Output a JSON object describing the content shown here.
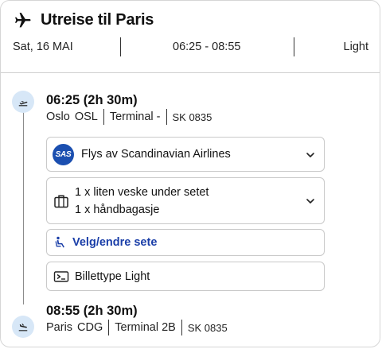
{
  "header": {
    "title": "Utreise til Paris",
    "date": "Sat, 16 MAI",
    "time_range": "06:25 - 08:55",
    "ticket_type": "Light",
    "icon": "plane-icon"
  },
  "departure": {
    "time_duration": "06:25  (2h 30m)",
    "city": "Oslo",
    "airport": "OSL",
    "terminal": "Terminal  -",
    "flight_no": "SK 0835",
    "icon": "takeoff-icon"
  },
  "details": {
    "airline": {
      "logo_text": "SAS",
      "label": "Flys av Scandinavian Airlines",
      "icon": "chevron-down-icon"
    },
    "baggage": {
      "line1": "1 x liten veske under setet",
      "line2": "1 x håndbagasje",
      "icon": "bag-icon"
    },
    "seat": {
      "label": "Velg/endre sete",
      "icon": "seat-icon"
    },
    "ticket": {
      "label": "Billettype Light",
      "icon": "ticket-icon"
    }
  },
  "arrival": {
    "time_duration": "08:55  (2h 30m)",
    "city": "Paris",
    "airport": "CDG",
    "terminal": "Terminal  2B",
    "flight_no": "SK 0835",
    "icon": "landing-icon"
  },
  "colors": {
    "accent_blue": "#1a3ea8",
    "sas_blue": "#1b4fb0",
    "timeline_dot": "#d7e7f7"
  }
}
